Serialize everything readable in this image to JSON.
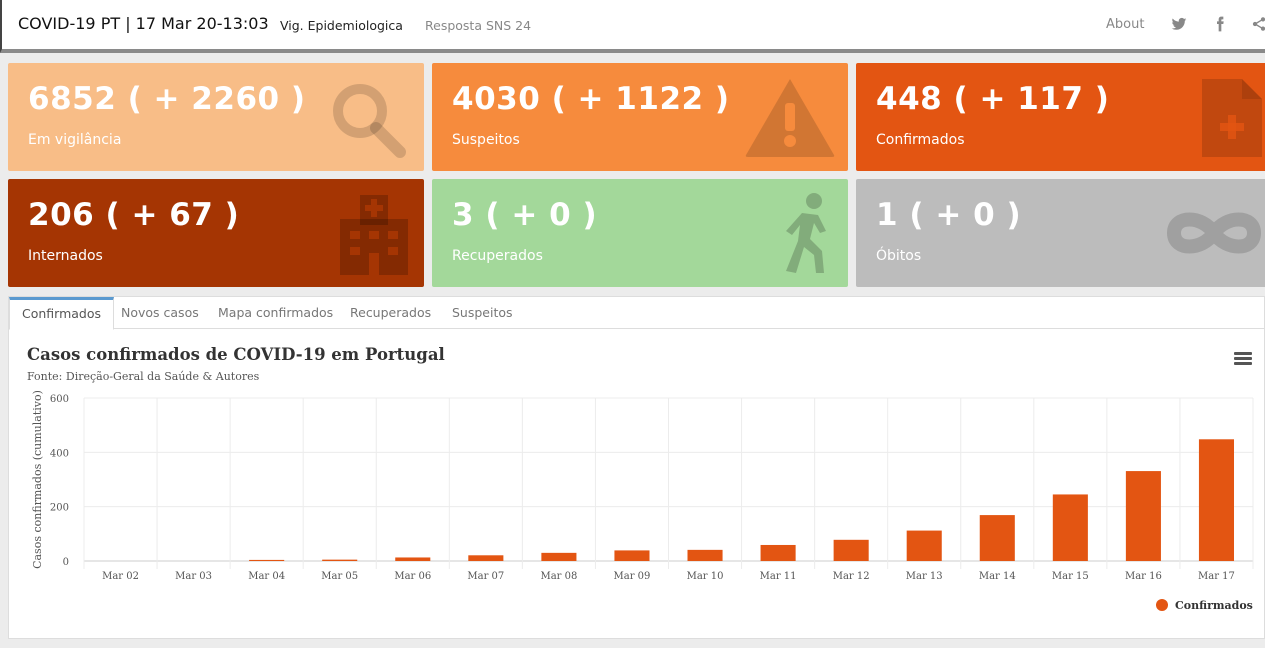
{
  "nav": {
    "brand": "COVID-19 PT | 17 Mar 20-13:03",
    "links": [
      "Vig. Epidemiologica",
      "Resposta SNS 24"
    ],
    "about": "About"
  },
  "boxes": [
    {
      "value": "6852 ( + 2260 )",
      "label": "Em vigilância",
      "color": "#f8bd87",
      "icon": "search-icon"
    },
    {
      "value": "4030 ( + 1122 )",
      "label": "Suspeitos",
      "color": "#f68b3d",
      "icon": "warning-icon"
    },
    {
      "value": "448 ( + 117 )",
      "label": "Confirmados",
      "color": "#e35512",
      "icon": "medical-file-icon"
    },
    {
      "value": "206 ( + 67 )",
      "label": "Internados",
      "color": "#a53503",
      "icon": "hospital-icon"
    },
    {
      "value": "3 ( + 0 )",
      "label": "Recuperados",
      "color": "#a3d89a",
      "icon": "walking-person-icon"
    },
    {
      "value": "1 ( + 0 )",
      "label": "Óbitos",
      "color": "#bcbcbc",
      "icon": "infinity-icon"
    }
  ],
  "tabs": [
    "Confirmados",
    "Novos casos",
    "Mapa confirmados",
    "Recuperados",
    "Suspeitos"
  ],
  "chart_data": {
    "type": "bar",
    "title": "Casos confirmados de COVID-19 em Portugal",
    "subtitle": "Fonte: Direção-Geral da Saúde & Autores",
    "ylabel": "Casos confirmados (cumulativo)",
    "xlabel": "",
    "ylim": [
      0,
      600
    ],
    "yticks": [
      0,
      200,
      400,
      600
    ],
    "grid": true,
    "legend_position": "bottom-right",
    "categories": [
      "Mar 02",
      "Mar 03",
      "Mar 04",
      "Mar 05",
      "Mar 06",
      "Mar 07",
      "Mar 08",
      "Mar 09",
      "Mar 10",
      "Mar 11",
      "Mar 12",
      "Mar 13",
      "Mar 14",
      "Mar 15",
      "Mar 16",
      "Mar 17"
    ],
    "series": [
      {
        "name": "Confirmados",
        "color": "#e35512",
        "values": [
          0,
          0,
          4,
          5,
          13,
          21,
          30,
          39,
          41,
          59,
          78,
          112,
          169,
          245,
          331,
          448
        ]
      }
    ]
  }
}
